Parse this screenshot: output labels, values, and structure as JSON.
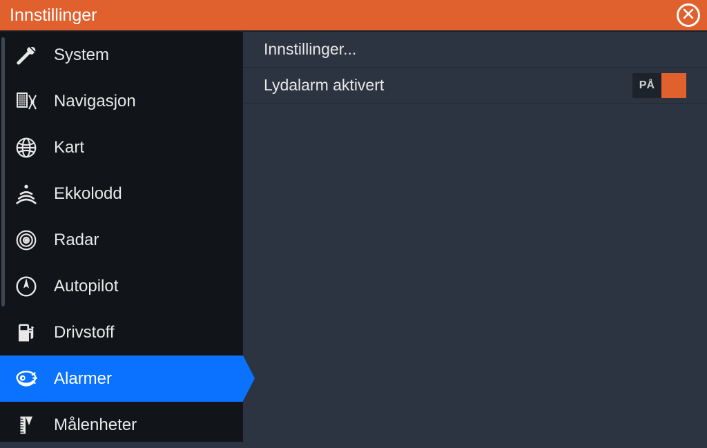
{
  "title": "Innstillinger",
  "sidebar": {
    "items": [
      {
        "label": "System",
        "icon": "wrench"
      },
      {
        "label": "Navigasjon",
        "icon": "nav"
      },
      {
        "label": "Kart",
        "icon": "globe"
      },
      {
        "label": "Ekkolodd",
        "icon": "sonar"
      },
      {
        "label": "Radar",
        "icon": "radar"
      },
      {
        "label": "Autopilot",
        "icon": "autopilot"
      },
      {
        "label": "Drivstoff",
        "icon": "fuel"
      },
      {
        "label": "Alarmer",
        "icon": "alarm"
      },
      {
        "label": "Målenheter",
        "icon": "ruler"
      }
    ],
    "activeIndex": 7
  },
  "content": {
    "rows": [
      {
        "label": "Innstillinger..."
      },
      {
        "label": "Lydalarm aktivert",
        "toggle": "PÅ"
      }
    ]
  }
}
